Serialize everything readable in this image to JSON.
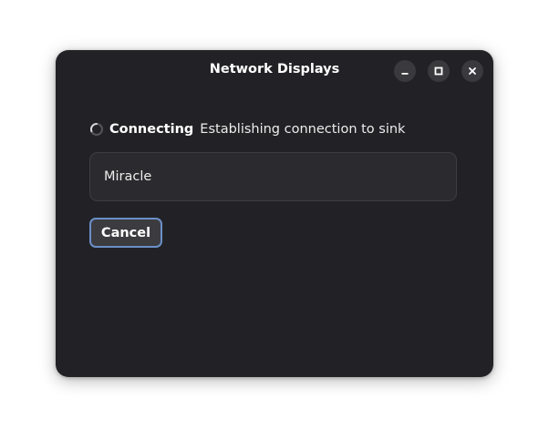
{
  "window": {
    "title": "Network Displays",
    "controls": {
      "minimize_icon": "minimize-icon",
      "maximize_icon": "maximize-icon",
      "close_icon": "close-icon"
    }
  },
  "status": {
    "icon": "spinner-icon",
    "label": "Connecting",
    "description": "Establishing connection to sink"
  },
  "sink": {
    "name": "Miracle"
  },
  "actions": {
    "cancel_label": "Cancel"
  },
  "colors": {
    "window_bg": "#222226",
    "focus_ring": "#6b8fc7"
  }
}
